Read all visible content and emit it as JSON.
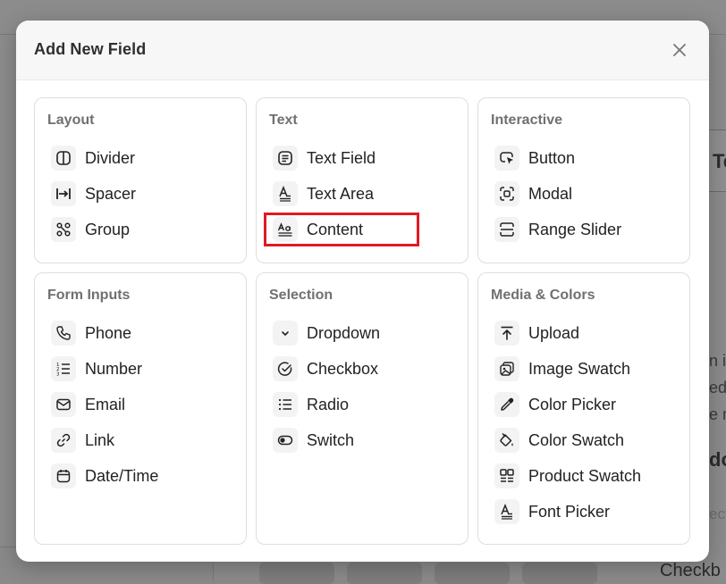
{
  "modal": {
    "title": "Add New Field"
  },
  "background_fragments": {
    "right_1": "Te",
    "right_2": "n ip",
    "right_3": "ed",
    "right_4": "e m",
    "right_5": "do",
    "right_6": "ect",
    "bottom": "Checkb"
  },
  "sections": {
    "layout": {
      "title": "Layout",
      "items": [
        {
          "label": "Divider",
          "icon": "divider-icon"
        },
        {
          "label": "Spacer",
          "icon": "spacer-icon"
        },
        {
          "label": "Group",
          "icon": "group-icon"
        }
      ]
    },
    "text": {
      "title": "Text",
      "items": [
        {
          "label": "Text Field",
          "icon": "text-field-icon"
        },
        {
          "label": "Text Area",
          "icon": "text-area-icon"
        },
        {
          "label": "Content",
          "icon": "content-icon"
        }
      ]
    },
    "interactive": {
      "title": "Interactive",
      "items": [
        {
          "label": "Button",
          "icon": "button-icon"
        },
        {
          "label": "Modal",
          "icon": "modal-icon"
        },
        {
          "label": "Range Slider",
          "icon": "range-slider-icon"
        }
      ]
    },
    "form_inputs": {
      "title": "Form Inputs",
      "items": [
        {
          "label": "Phone",
          "icon": "phone-icon"
        },
        {
          "label": "Number",
          "icon": "number-icon"
        },
        {
          "label": "Email",
          "icon": "email-icon"
        },
        {
          "label": "Link",
          "icon": "link-icon"
        },
        {
          "label": "Date/Time",
          "icon": "calendar-icon"
        }
      ]
    },
    "selection": {
      "title": "Selection",
      "items": [
        {
          "label": "Dropdown",
          "icon": "chevron-down-icon"
        },
        {
          "label": "Checkbox",
          "icon": "checkbox-icon"
        },
        {
          "label": "Radio",
          "icon": "radio-list-icon"
        },
        {
          "label": "Switch",
          "icon": "switch-icon"
        }
      ]
    },
    "media_colors": {
      "title": "Media & Colors",
      "items": [
        {
          "label": "Upload",
          "icon": "upload-icon"
        },
        {
          "label": "Image Swatch",
          "icon": "image-swatch-icon"
        },
        {
          "label": "Color Picker",
          "icon": "color-picker-icon"
        },
        {
          "label": "Color Swatch",
          "icon": "color-swatch-icon"
        },
        {
          "label": "Product Swatch",
          "icon": "product-swatch-icon"
        },
        {
          "label": "Font Picker",
          "icon": "font-picker-icon"
        }
      ]
    }
  },
  "colors": {
    "highlight": "#e01a22",
    "overlay": "#8c8c8c"
  }
}
